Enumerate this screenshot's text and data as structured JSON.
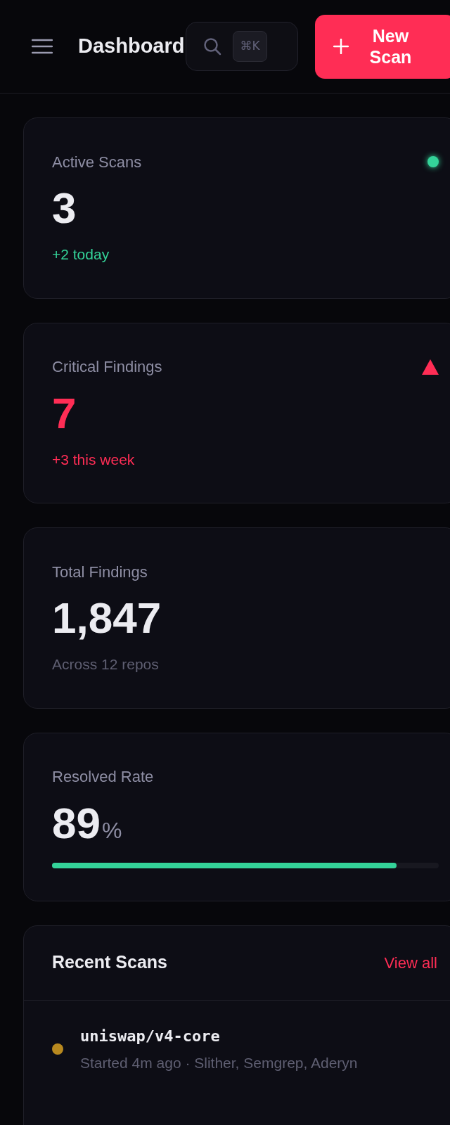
{
  "header": {
    "title": "Dashboard",
    "search": {
      "shortcut": "⌘K"
    },
    "new_scan_button": {
      "label": "New Scan"
    }
  },
  "stats": [
    {
      "kind": "live",
      "label": "Active Scans",
      "value": "3",
      "note": "+2 today",
      "color": "#34d399"
    },
    {
      "kind": "alert",
      "label": "Critical Findings",
      "value": "7",
      "note": "+3 this week",
      "color": "#ff2d55"
    },
    {
      "kind": "count",
      "label": "Total Findings",
      "value": "1,847",
      "note": "Across 12 repos"
    },
    {
      "kind": "rate",
      "label": "Resolved Rate",
      "value": "89",
      "unit": "%",
      "level": 0.89
    }
  ],
  "recent_scans": {
    "title": "Recent Scans",
    "link": "View all",
    "items": [
      {
        "repo": "uniswap/v4-core",
        "meta": "Started 4m ago · Slither, Semgrep, Aderyn",
        "color": "#b8891f"
      }
    ]
  }
}
